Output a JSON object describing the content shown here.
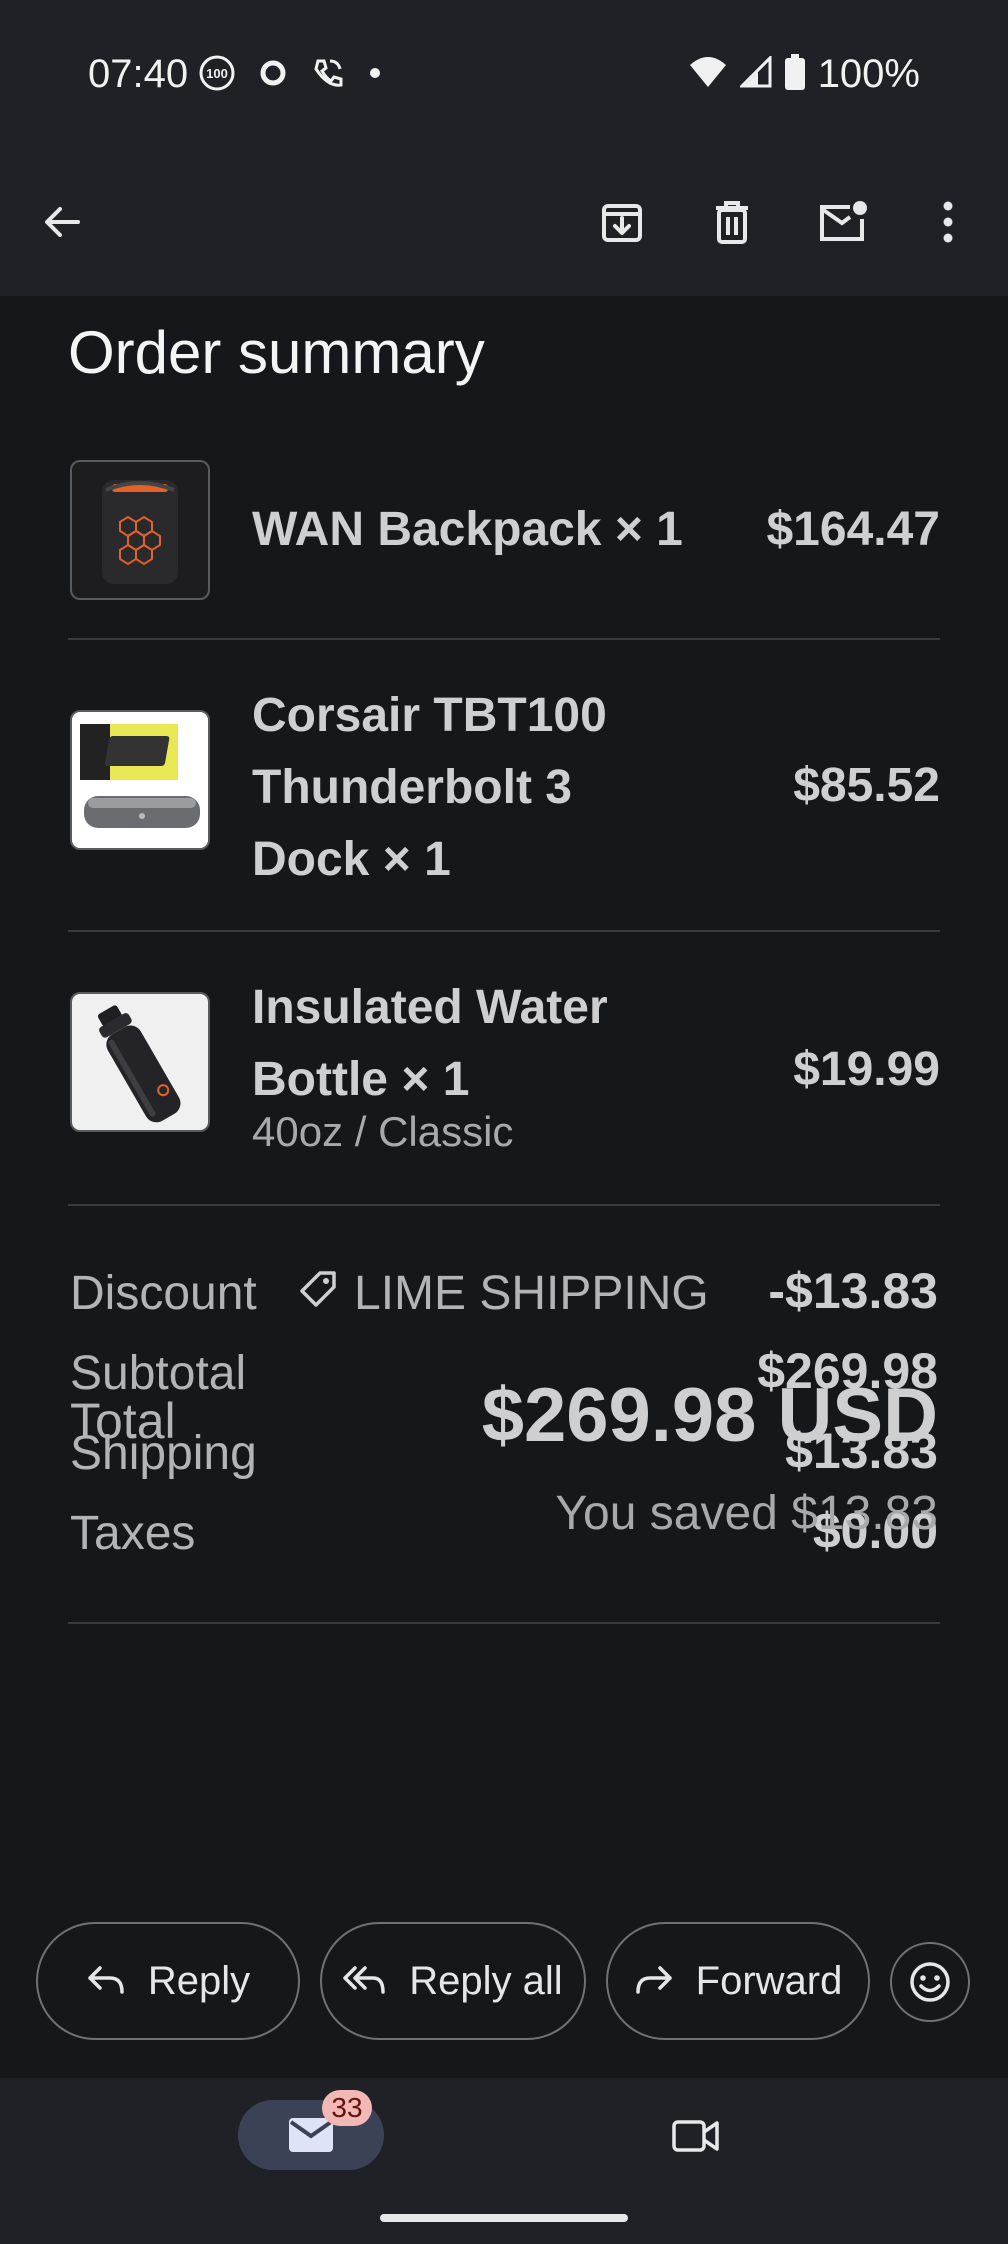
{
  "status_bar": {
    "time": "07:40",
    "battery_percent": "100%",
    "icons": [
      "100-badge-icon",
      "circle-icon",
      "wifi-call-icon",
      "dot-icon",
      "wifi-icon",
      "signal-icon",
      "battery-icon"
    ]
  },
  "toolbar": {
    "icons": [
      "back-arrow-icon",
      "archive-icon",
      "delete-icon",
      "mark-unread-icon",
      "more-vert-icon"
    ]
  },
  "order": {
    "heading": "Order summary",
    "items": [
      {
        "name_line1": "WAN Backpack × 1",
        "name_line2": "",
        "name_line3": "",
        "variant": "",
        "price": "$164.47",
        "thumb": "backpack-image"
      },
      {
        "name_line1": "Corsair TBT100",
        "name_line2": "Thunderbolt 3",
        "name_line3": "Dock × 1",
        "variant": "",
        "price": "$85.52",
        "thumb": "dock-image"
      },
      {
        "name_line1": "Insulated Water",
        "name_line2": "Bottle × 1",
        "name_line3": "",
        "variant": "40oz / Classic",
        "price": "$19.99",
        "thumb": "bottle-image"
      }
    ],
    "summary": {
      "discount_label": "Discount",
      "discount_code": "LIME SHIPPING",
      "discount_value": "-$13.83",
      "subtotal_label": "Subtotal",
      "subtotal_value": "$269.98",
      "shipping_label": "Shipping",
      "shipping_value": "$13.83",
      "taxes_label": "Taxes",
      "taxes_value": "$0.00"
    },
    "total_label": "Total",
    "total_value": "$269.98 USD",
    "saved_text": "You saved $13.83"
  },
  "actions": {
    "reply": "Reply",
    "reply_all": "Reply all",
    "forward": "Forward"
  },
  "bottom_nav": {
    "mail_badge": "33"
  },
  "colors": {
    "background": "#16171b",
    "bars": "#202126",
    "badge": "#f2b8b5",
    "mail_pill": "#3c4256"
  }
}
